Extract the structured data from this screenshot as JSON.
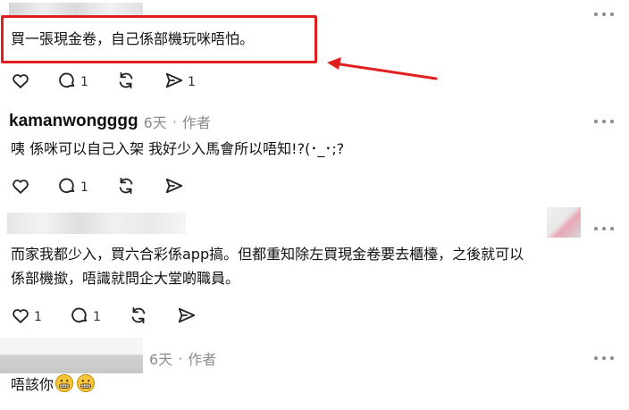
{
  "accent_red": "#e0201e",
  "comments": [
    {
      "text": "買一張現金卷，自己係部機玩咪唔怕。",
      "actions": {
        "like": "",
        "reply": "1",
        "repost": "",
        "share": "1"
      }
    },
    {
      "username": "kamanwongggg",
      "time": "6天",
      "sep": "·",
      "role": "作者",
      "text": "咦 係咪可以自己入架 我好少入馬會所以唔知!?(･_･;?",
      "actions": {
        "like": "",
        "reply": "1",
        "repost": "",
        "share": ""
      }
    },
    {
      "text_lines": [
        "而家我都少入，買六合彩係app搞。但都重知除左買現金卷要去櫃檯，之後就可以",
        "係部機撳，唔識就問企大堂啲職員。"
      ],
      "actions": {
        "like": "1",
        "reply": "1",
        "repost": "",
        "share": ""
      }
    },
    {
      "time": "6天",
      "sep": "·",
      "role": "作者",
      "text": "唔該你",
      "emoji": [
        "grimacing-face",
        "grimacing-face"
      ]
    }
  ],
  "icons": {
    "like": "heart-icon",
    "reply": "comment-icon",
    "repost": "repost-icon",
    "share": "send-icon",
    "more": "more-icon"
  }
}
